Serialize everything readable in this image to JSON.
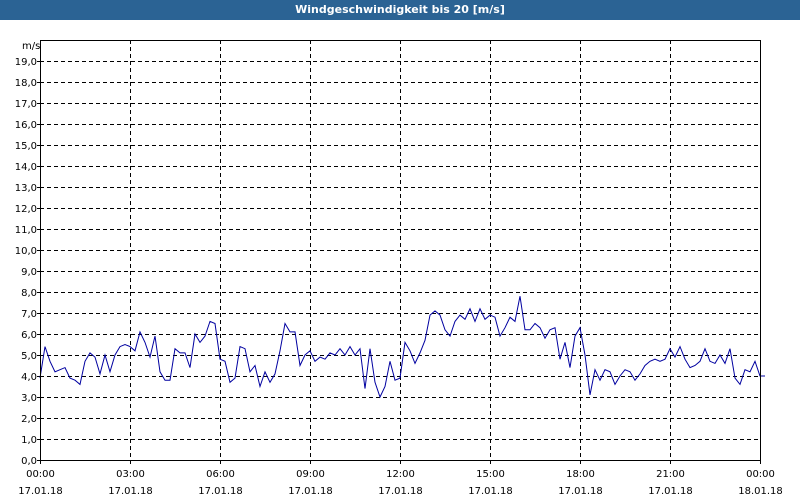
{
  "window": {
    "title": "Windgeschwindigkeit bis 20 [m/s]"
  },
  "chart_data": {
    "type": "line",
    "title": "Windgeschwindigkeit bis 20 [m/s]",
    "ylabel": "m/s",
    "ylim": [
      0,
      20
    ],
    "yticks": [
      "0,0",
      "1,0",
      "2,0",
      "3,0",
      "4,0",
      "5,0",
      "6,0",
      "7,0",
      "8,0",
      "9,0",
      "10,0",
      "11,0",
      "12,0",
      "13,0",
      "14,0",
      "15,0",
      "16,0",
      "17,0",
      "18,0",
      "19,0"
    ],
    "xticks": [
      {
        "time": "00:00",
        "date": "17.01.18"
      },
      {
        "time": "03:00",
        "date": "17.01.18"
      },
      {
        "time": "06:00",
        "date": "17.01.18"
      },
      {
        "time": "09:00",
        "date": "17.01.18"
      },
      {
        "time": "12:00",
        "date": "17.01.18"
      },
      {
        "time": "15:00",
        "date": "17.01.18"
      },
      {
        "time": "18:00",
        "date": "17.01.18"
      },
      {
        "time": "21:00",
        "date": "17.01.18"
      },
      {
        "time": "00:00",
        "date": "18.01.18"
      }
    ],
    "xlim_hours": [
      0,
      24
    ],
    "grid": true,
    "series_color": "#0000a0",
    "series": [
      {
        "interval_minutes": 10,
        "values": [
          3.9,
          5.4,
          4.7,
          4.2,
          4.3,
          4.4,
          3.9,
          3.8,
          3.6,
          4.7,
          5.1,
          4.9,
          4.1,
          5.0,
          4.2,
          5.0,
          5.4,
          5.5,
          5.4,
          5.2,
          6.1,
          5.6,
          4.9,
          5.9,
          4.2,
          3.8,
          3.8,
          5.3,
          5.1,
          5.1,
          4.4,
          6.0,
          5.6,
          5.9,
          6.6,
          6.5,
          4.8,
          4.7,
          3.7,
          3.9,
          5.4,
          5.3,
          4.2,
          4.5,
          3.5,
          4.2,
          3.7,
          4.1,
          5.2,
          6.5,
          6.1,
          6.1,
          4.5,
          5.0,
          5.2,
          4.7,
          4.9,
          4.8,
          5.1,
          5.0,
          5.3,
          5.0,
          5.4,
          5.0,
          5.3,
          3.4,
          5.3,
          3.7,
          3.0,
          3.5,
          4.7,
          3.8,
          3.9,
          5.6,
          5.2,
          4.6,
          5.1,
          5.7,
          6.9,
          7.1,
          6.9,
          6.2,
          5.9,
          6.6,
          6.9,
          6.7,
          7.2,
          6.6,
          7.2,
          6.7,
          6.9,
          6.8,
          5.9,
          6.3,
          6.8,
          6.6,
          7.8,
          6.2,
          6.2,
          6.5,
          6.3,
          5.8,
          6.2,
          6.3,
          4.8,
          5.6,
          4.4,
          5.9,
          6.3,
          5.0,
          3.1,
          4.3,
          3.8,
          4.3,
          4.2,
          3.6,
          4.0,
          4.3,
          4.2,
          3.8,
          4.1,
          4.5,
          4.7,
          4.8,
          4.7,
          4.8,
          5.3,
          4.9,
          5.4,
          4.8,
          4.4,
          4.5,
          4.7,
          5.3,
          4.7,
          4.6,
          5.0,
          4.6,
          5.3,
          3.9,
          3.6,
          4.3,
          4.2,
          4.7,
          4.0,
          4.0
        ]
      }
    ]
  }
}
